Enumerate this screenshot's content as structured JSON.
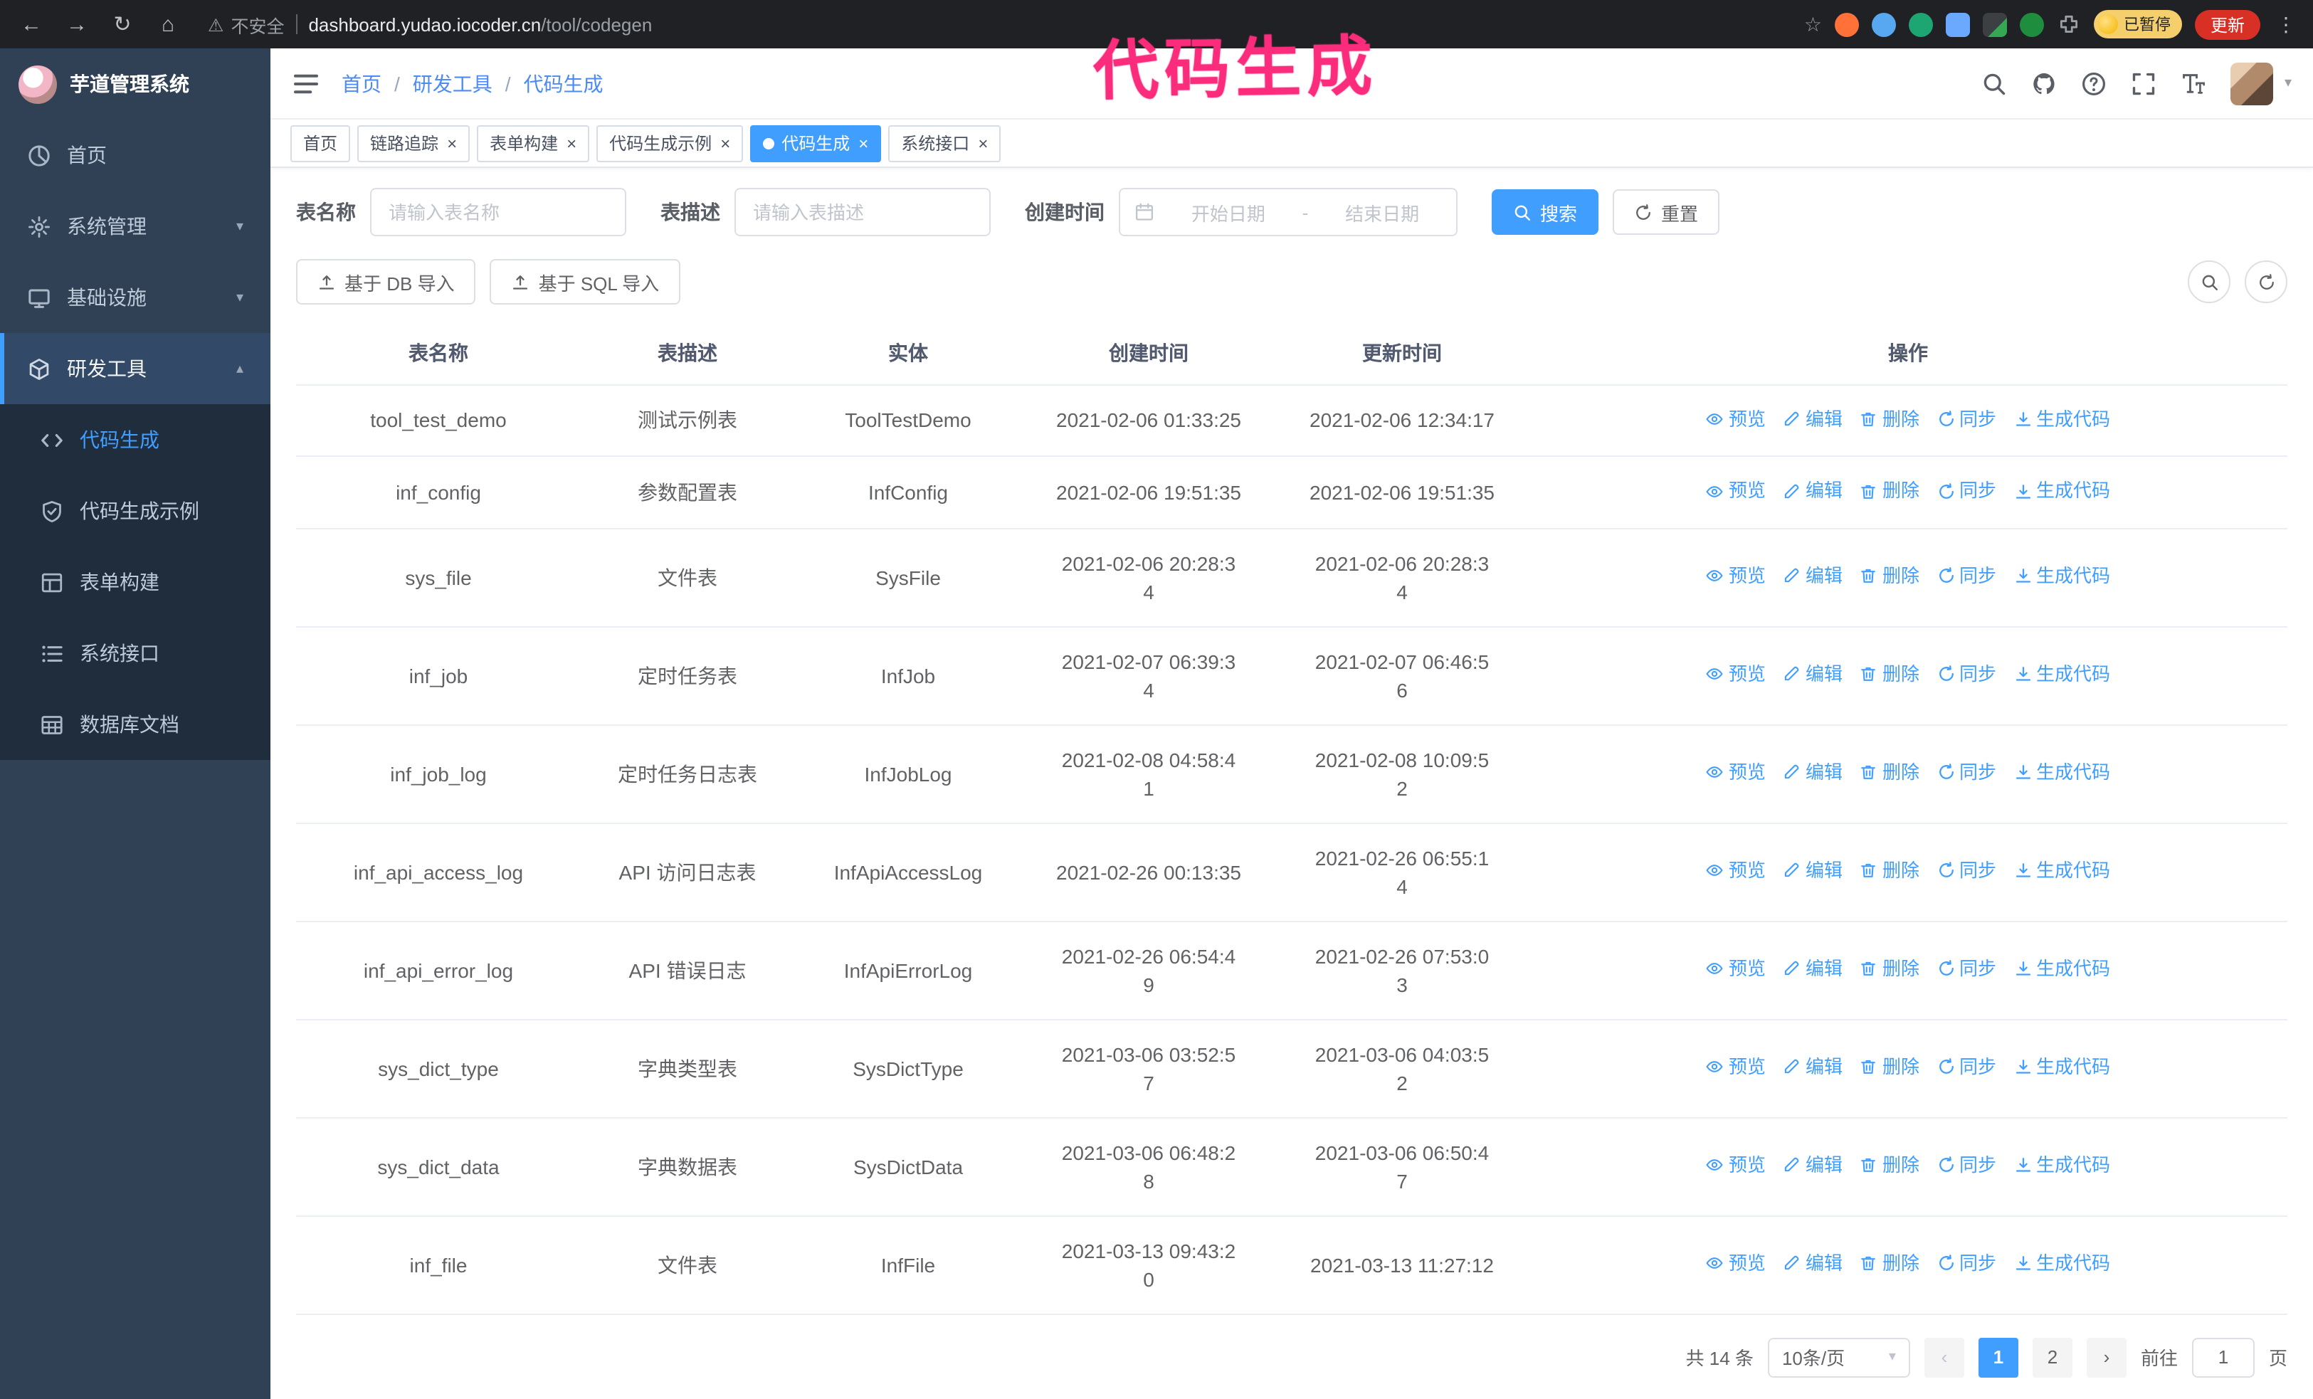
{
  "glyphs": {
    "back": "←",
    "forward": "→",
    "reload": "↻",
    "home": "⌂",
    "warning": "⚠",
    "star": "☆",
    "kebab": "⋮",
    "close": "×",
    "caret_down": "▾",
    "caret_up": "▴",
    "prev": "‹",
    "next": "›"
  },
  "browser": {
    "security_label": "不安全",
    "url_host": "dashboard.yudao.iocoder.cn",
    "url_path": "/tool/codegen",
    "paused_badge": "已暂停",
    "update_button": "更新"
  },
  "annotation": {
    "text": "代码生成",
    "color": "#fa2c7b"
  },
  "sidebar": {
    "logo_title": "芋道管理系统",
    "items": [
      {
        "label": "首页"
      },
      {
        "label": "系统管理"
      },
      {
        "label": "基础设施"
      },
      {
        "label": "研发工具"
      }
    ],
    "submenu": [
      {
        "label": "代码生成"
      },
      {
        "label": "代码生成示例"
      },
      {
        "label": "表单构建"
      },
      {
        "label": "系统接口"
      },
      {
        "label": "数据库文档"
      }
    ]
  },
  "breadcrumb": {
    "items": [
      "首页",
      "研发工具",
      "代码生成"
    ],
    "separator": "/"
  },
  "tabs": [
    {
      "label": "首页"
    },
    {
      "label": "链路追踪"
    },
    {
      "label": "表单构建"
    },
    {
      "label": "代码生成示例"
    },
    {
      "label": "代码生成"
    },
    {
      "label": "系统接口"
    }
  ],
  "filters": {
    "name_label": "表名称",
    "name_placeholder": "请输入表名称",
    "desc_label": "表描述",
    "desc_placeholder": "请输入表描述",
    "time_label": "创建时间",
    "start_placeholder": "开始日期",
    "range_separator": "-",
    "end_placeholder": "结束日期",
    "search": "搜索",
    "reset": "重置"
  },
  "toolbar": {
    "import_db": "基于 DB 导入",
    "import_sql": "基于 SQL 导入"
  },
  "table": {
    "columns": [
      "表名称",
      "表描述",
      "实体",
      "创建时间",
      "更新时间",
      "操作"
    ],
    "actions": [
      {
        "label": "预览",
        "icon": "eye",
        "name": "preview"
      },
      {
        "label": "编辑",
        "icon": "edit",
        "name": "edit"
      },
      {
        "label": "删除",
        "icon": "trash",
        "name": "delete"
      },
      {
        "label": "同步",
        "icon": "sync",
        "name": "sync"
      },
      {
        "label": "生成代码",
        "icon": "download",
        "name": "generate-code"
      }
    ],
    "rows": [
      {
        "name": "tool_test_demo",
        "desc": "测试示例表",
        "entity": "ToolTestDemo",
        "created": "2021-02-06 01:33:25",
        "updated": "2021-02-06 12:34:17"
      },
      {
        "name": "inf_config",
        "desc": "参数配置表",
        "entity": "InfConfig",
        "created": "2021-02-06 19:51:35",
        "updated": "2021-02-06 19:51:35"
      },
      {
        "name": "sys_file",
        "desc": "文件表",
        "entity": "SysFile",
        "created": "2021-02-06 20:28:3\n4",
        "updated": "2021-02-06 20:28:3\n4"
      },
      {
        "name": "inf_job",
        "desc": "定时任务表",
        "entity": "InfJob",
        "created": "2021-02-07 06:39:3\n4",
        "updated": "2021-02-07 06:46:5\n6"
      },
      {
        "name": "inf_job_log",
        "desc": "定时任务日志表",
        "entity": "InfJobLog",
        "created": "2021-02-08 04:58:4\n1",
        "updated": "2021-02-08 10:09:5\n2"
      },
      {
        "name": "inf_api_access_log",
        "desc": "API 访问日志表",
        "entity": "InfApiAccessLog",
        "created": "2021-02-26 00:13:35",
        "updated": "2021-02-26 06:55:1\n4"
      },
      {
        "name": "inf_api_error_log",
        "desc": "API 错误日志",
        "entity": "InfApiErrorLog",
        "created": "2021-02-26 06:54:4\n9",
        "updated": "2021-02-26 07:53:0\n3"
      },
      {
        "name": "sys_dict_type",
        "desc": "字典类型表",
        "entity": "SysDictType",
        "created": "2021-03-06 03:52:5\n7",
        "updated": "2021-03-06 04:03:5\n2"
      },
      {
        "name": "sys_dict_data",
        "desc": "字典数据表",
        "entity": "SysDictData",
        "created": "2021-03-06 06:48:2\n8",
        "updated": "2021-03-06 06:50:4\n7"
      },
      {
        "name": "inf_file",
        "desc": "文件表",
        "entity": "InfFile",
        "created": "2021-03-13 09:43:2\n0",
        "updated": "2021-03-13 11:27:12"
      }
    ]
  },
  "pagination": {
    "total": "共 14 条",
    "page_size": "10条/页",
    "page_1": "1",
    "page_2": "2",
    "goto_label": "前往",
    "goto_value": "1",
    "goto_suffix": "页"
  }
}
